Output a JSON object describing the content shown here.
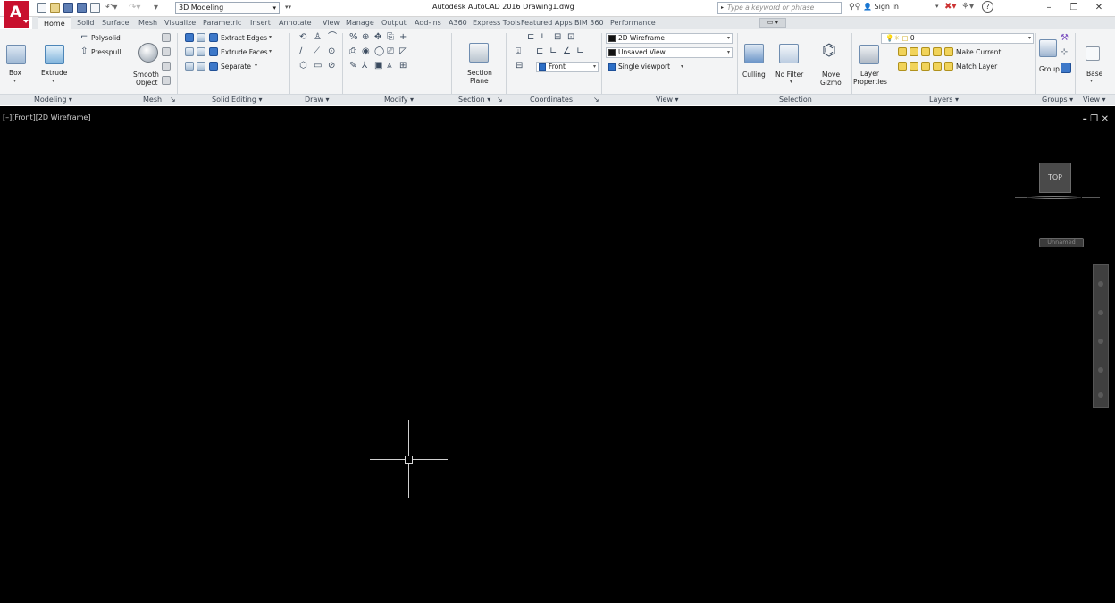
{
  "titlebar": {
    "workspace": "3D Modeling",
    "title": "Autodesk AutoCAD 2016   Drawing1.dwg",
    "search_placeholder": "Type a keyword or phrase",
    "signin": "Sign In",
    "minimize": "–",
    "restore": "❐",
    "close": "✕"
  },
  "tabs": [
    "Home",
    "Solid",
    "Surface",
    "Mesh",
    "Visualize",
    "Parametric",
    "Insert",
    "Annotate",
    "View",
    "Manage",
    "Output",
    "Add-ins",
    "A360",
    "Express Tools",
    "Featured Apps",
    "BIM 360",
    "Performance"
  ],
  "ribbon": {
    "modeling": {
      "box": "Box",
      "extrude": "Extrude",
      "polysolid": "Polysolid",
      "presspull": "Presspull",
      "title": "Modeling ▾"
    },
    "mesh": {
      "smooth_object_1": "Smooth",
      "smooth_object_2": "Object",
      "title": "Mesh"
    },
    "solid_editing": {
      "extract_edges": "Extract Edges",
      "extrude_faces": "Extrude Faces",
      "separate": "Separate",
      "title": "Solid Editing ▾"
    },
    "draw": {
      "title": "Draw ▾"
    },
    "modify": {
      "title": "Modify ▾"
    },
    "section": {
      "section_plane_1": "Section",
      "section_plane_2": "Plane",
      "title": "Section ▾"
    },
    "coordinates": {
      "front": "Front",
      "title": "Coordinates"
    },
    "view": {
      "visual_style": "2D Wireframe",
      "named_view": "Unsaved View",
      "viewport": "Single viewport",
      "title": "View ▾"
    },
    "selection": {
      "culling": "Culling",
      "no_filter": "No Filter",
      "move_gizmo_1": "Move",
      "move_gizmo_2": "Gizmo",
      "title": "Selection"
    },
    "layers": {
      "layer_properties_1": "Layer",
      "layer_properties_2": "Properties",
      "current_layer": "0",
      "make_current": "Make Current",
      "match_layer": "Match Layer",
      "title": "Layers ▾"
    },
    "groups": {
      "group": "Group",
      "title": "Groups ▾"
    },
    "viewpanel2": {
      "base": "Base",
      "title": "View ▾"
    }
  },
  "canvas": {
    "viewport_label": "[–][Front][2D Wireframe]",
    "viewport_controls": "– ❐ ✕",
    "viewcube_face": "TOP",
    "wcs": "Unnamed"
  }
}
